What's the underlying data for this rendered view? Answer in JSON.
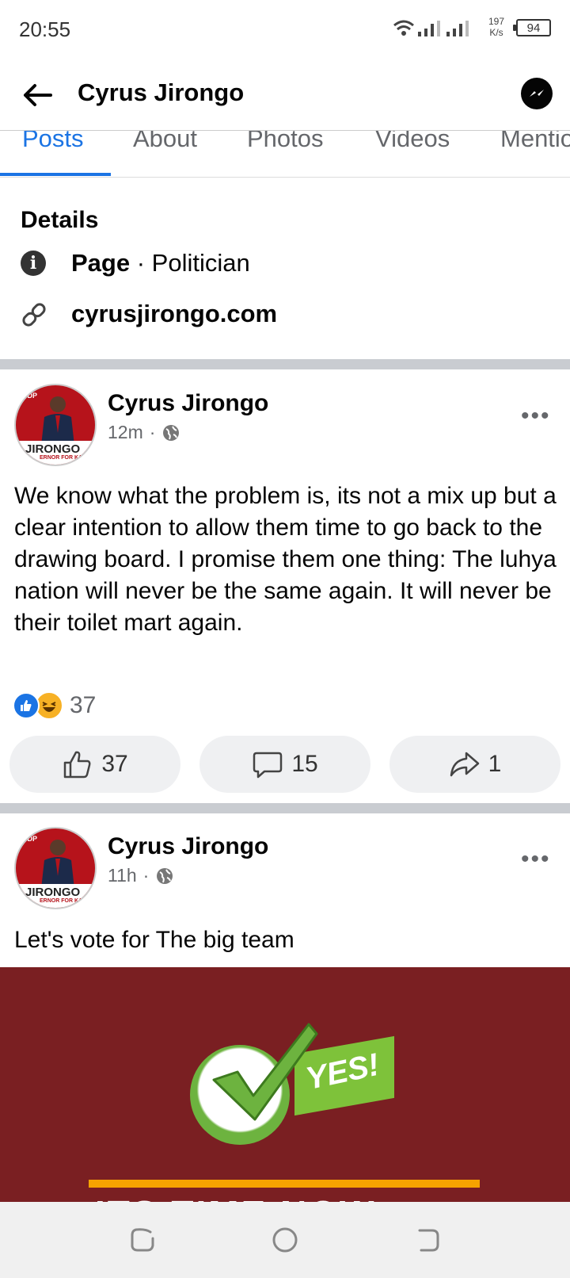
{
  "status_bar": {
    "time": "20:55",
    "net_speed_value": "197",
    "net_speed_unit": "K/s",
    "battery": "94"
  },
  "header": {
    "title": "Cyrus Jirongo",
    "icons": [
      "back-arrow-icon",
      "messenger-icon"
    ]
  },
  "tabs": [
    {
      "label": "Posts",
      "active": true
    },
    {
      "label": "About"
    },
    {
      "label": "Photos"
    },
    {
      "label": "Videos"
    },
    {
      "label": "Mentio"
    }
  ],
  "details": {
    "title": "Details",
    "category_prefix": "Page",
    "category_separator": " · ",
    "category": "Politician",
    "website": "cyrusjirongo.com"
  },
  "avatar": {
    "udp": "UDP",
    "brand": "JIRONGO",
    "subtitle": "ERNOR FOR KAKA"
  },
  "posts": [
    {
      "author": "Cyrus Jirongo",
      "time": "12m",
      "separator": "·",
      "text": "We know what the problem is, its not a mix up but a clear intention to allow them time to go back to the drawing board. I promise them one thing: The luhya nation will never be the same again. It will never be their toilet mart again.",
      "reaction_count": "37",
      "actions": {
        "like": "37",
        "comment": "15",
        "share": "1"
      }
    },
    {
      "author": "Cyrus Jirongo",
      "time": "11h",
      "separator": "·",
      "text": "Let's vote for The big team",
      "image": {
        "yes_text": "YES!",
        "bottom_text": "ITS TIME NOW"
      }
    }
  ],
  "colors": {
    "accent": "#1b74e4",
    "divider": "#c9ccd1",
    "image_bg": "#7a1f22"
  }
}
